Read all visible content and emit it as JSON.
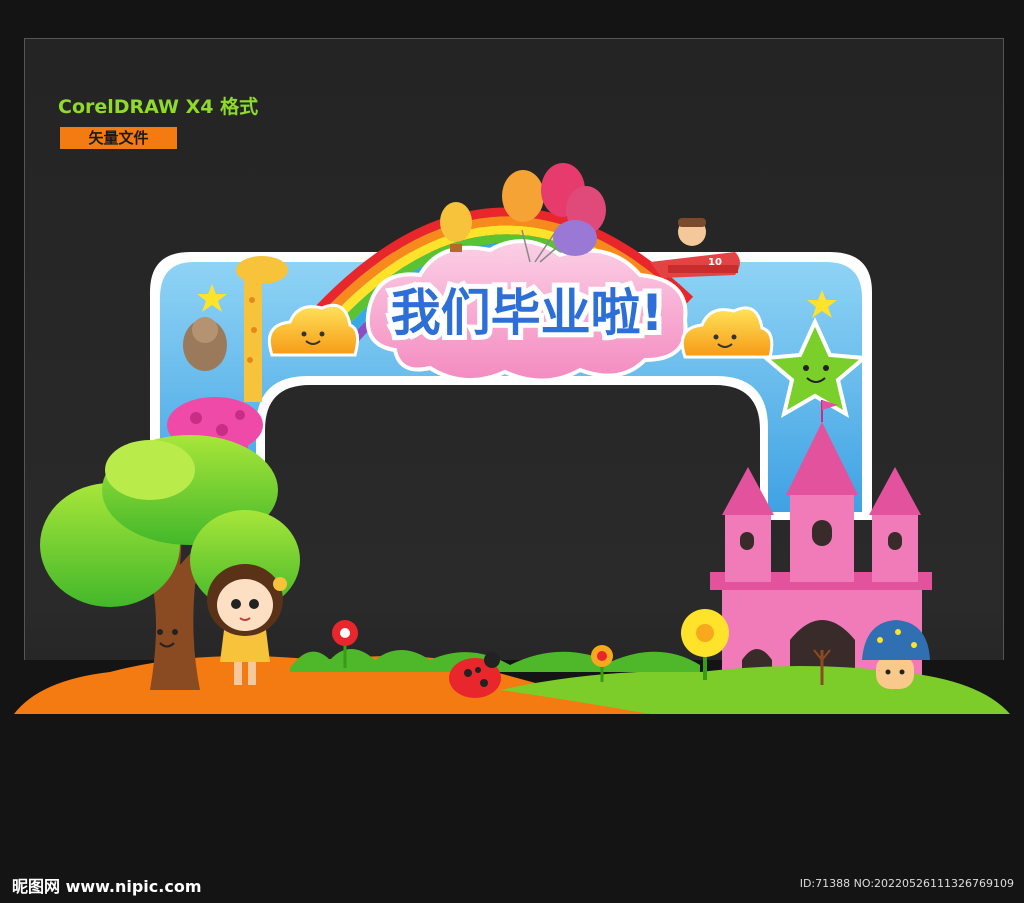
{
  "format_label": "CorelDRAW X4 格式",
  "file_tag": "矢量文件",
  "banner_title": "我们毕业啦!",
  "plane_number": "10",
  "footer": {
    "site": "昵图网 www.nipic.com",
    "id": "ID:71388 NO:20220526111326769109"
  },
  "colors": {
    "format_label": "#8edb2c",
    "file_tag_bg": "#f47a12",
    "arch_blue": "#5ab7ec",
    "castle_pink": "#f07bb8",
    "ground_orange": "#f47a12",
    "ground_green": "#7ccd2a"
  }
}
